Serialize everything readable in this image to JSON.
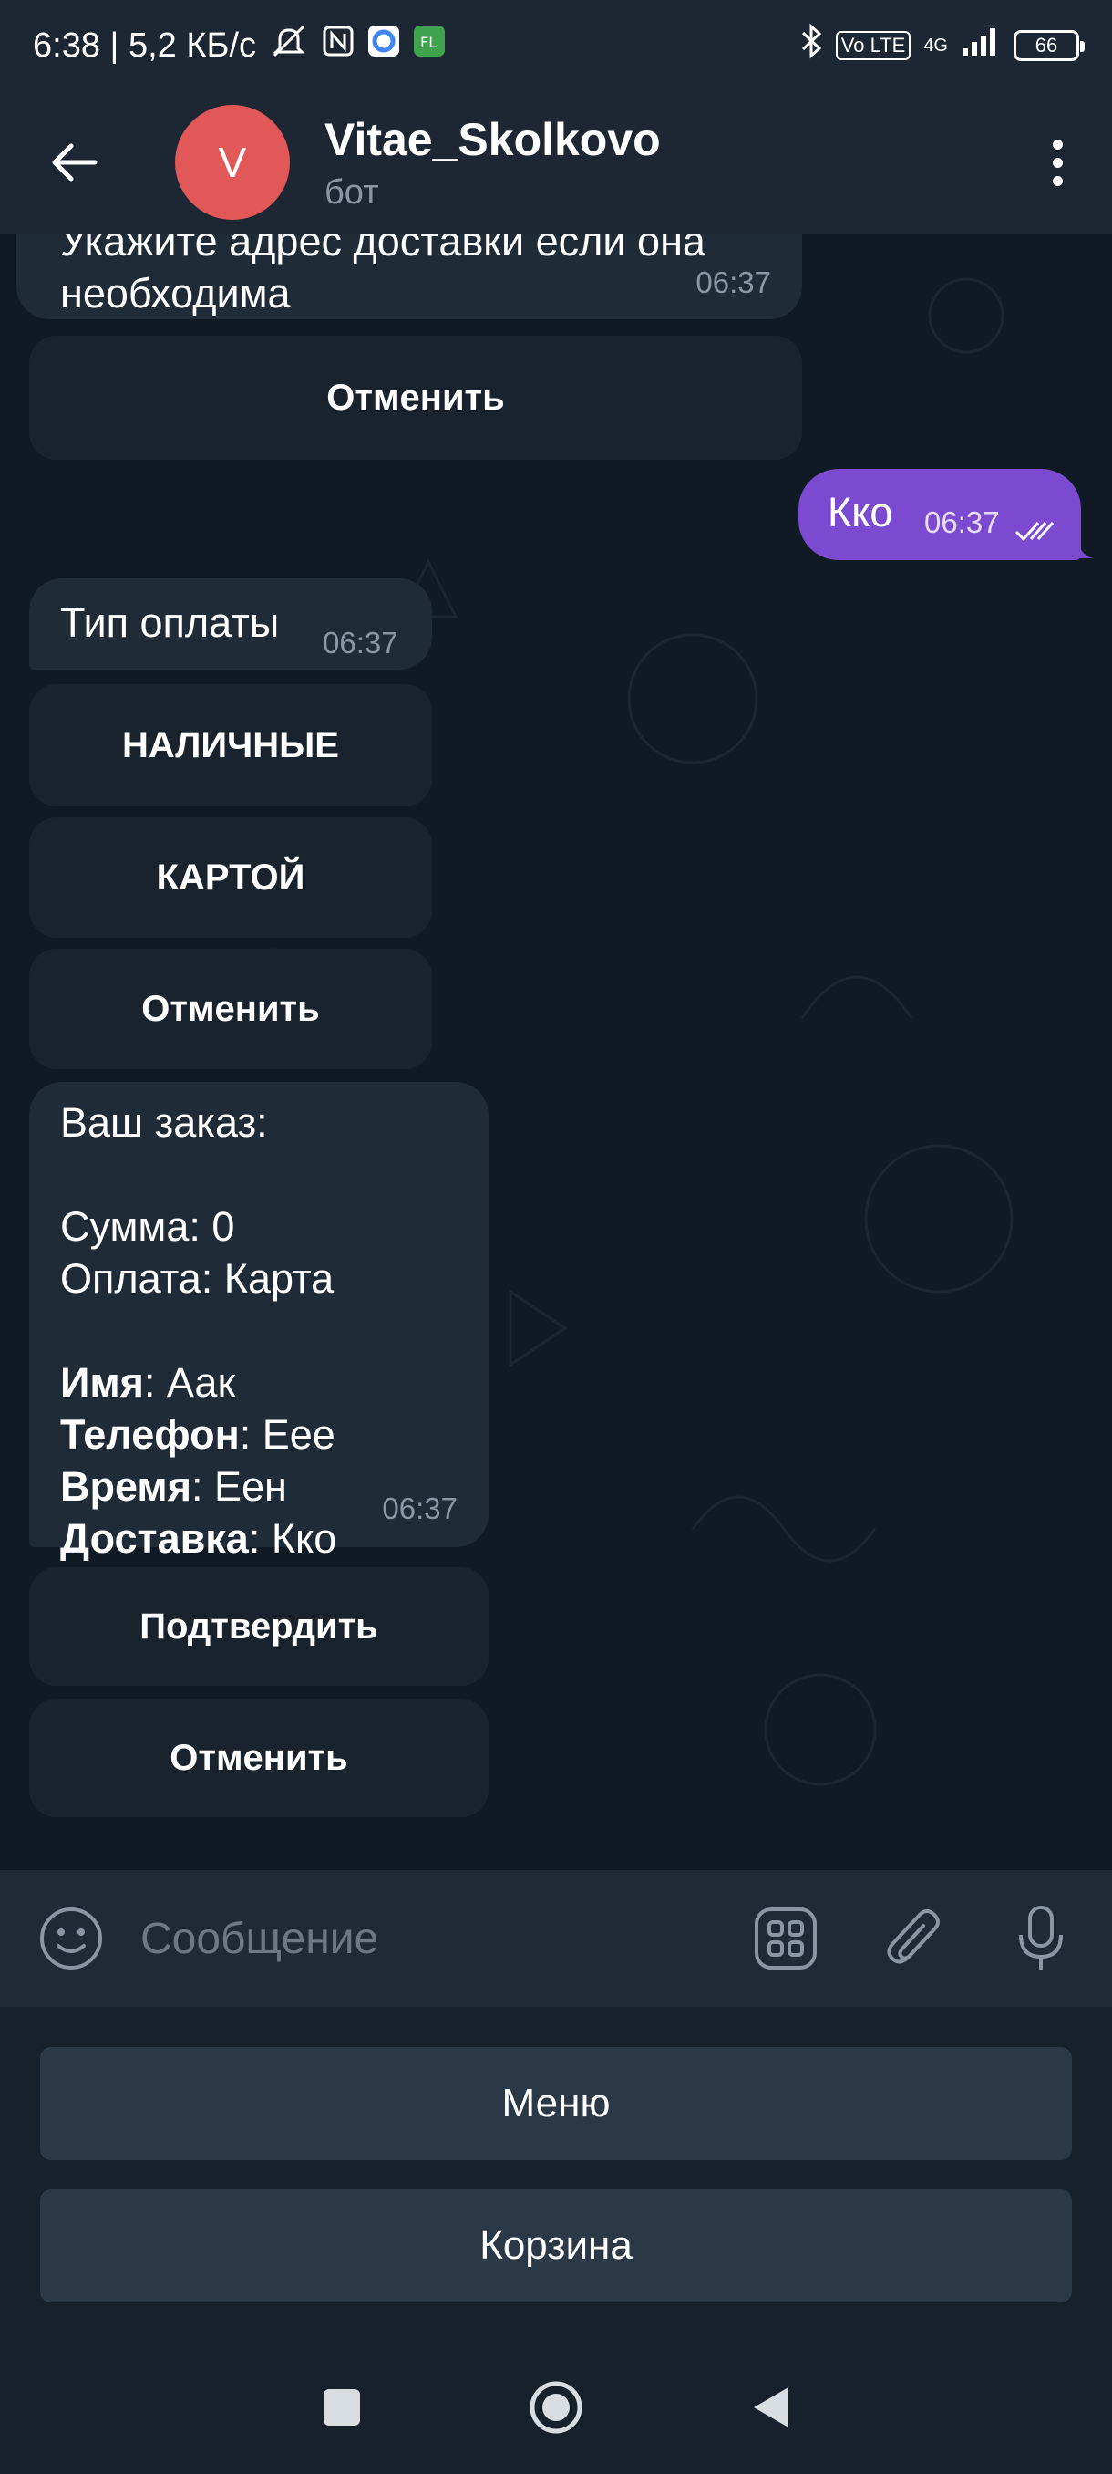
{
  "status_bar": {
    "time_speed": "6:38 | 5,2 КБ/с",
    "network": "4G",
    "volte": "Vo LTE",
    "battery": "66"
  },
  "header": {
    "avatar_letter": "V",
    "title": "Vitae_Skolkovo",
    "subtitle": "бот"
  },
  "messages": {
    "m1": {
      "partial_line": "Укажите адрес доставки если она",
      "line2": "необходима",
      "time": "06:37",
      "cancel": "Отменить"
    },
    "m2": {
      "text": "Кко",
      "time": "06:37"
    },
    "m3": {
      "text": "Тип оплаты",
      "time": "06:37",
      "btn_cash": "НАЛИЧНЫЕ",
      "btn_card": "КАРТОЙ",
      "cancel": "Отменить"
    },
    "m4": {
      "line1": "Ваш заказ:",
      "sum": "Сумма: 0",
      "payment": "Оплата: Карта",
      "name_label": "Имя",
      "name_value": ": Аак",
      "phone_label": "Телефон",
      "phone_value": ": Еее",
      "time_label": "Время",
      "time_value": ": Еен",
      "delivery_label": "Доставка",
      "delivery_value": ": Кко",
      "time": "06:37",
      "confirm": "Подтвердить",
      "cancel": "Отменить"
    }
  },
  "input": {
    "placeholder": "Сообщение"
  },
  "reply_keyboard": {
    "menu": "Меню",
    "cart": "Корзина"
  },
  "colors": {
    "header_bg": "#1c2733",
    "avatar": "#e25757",
    "outgoing_bubble": "#7b4ad1",
    "incoming_bubble": "#1f2b37"
  }
}
